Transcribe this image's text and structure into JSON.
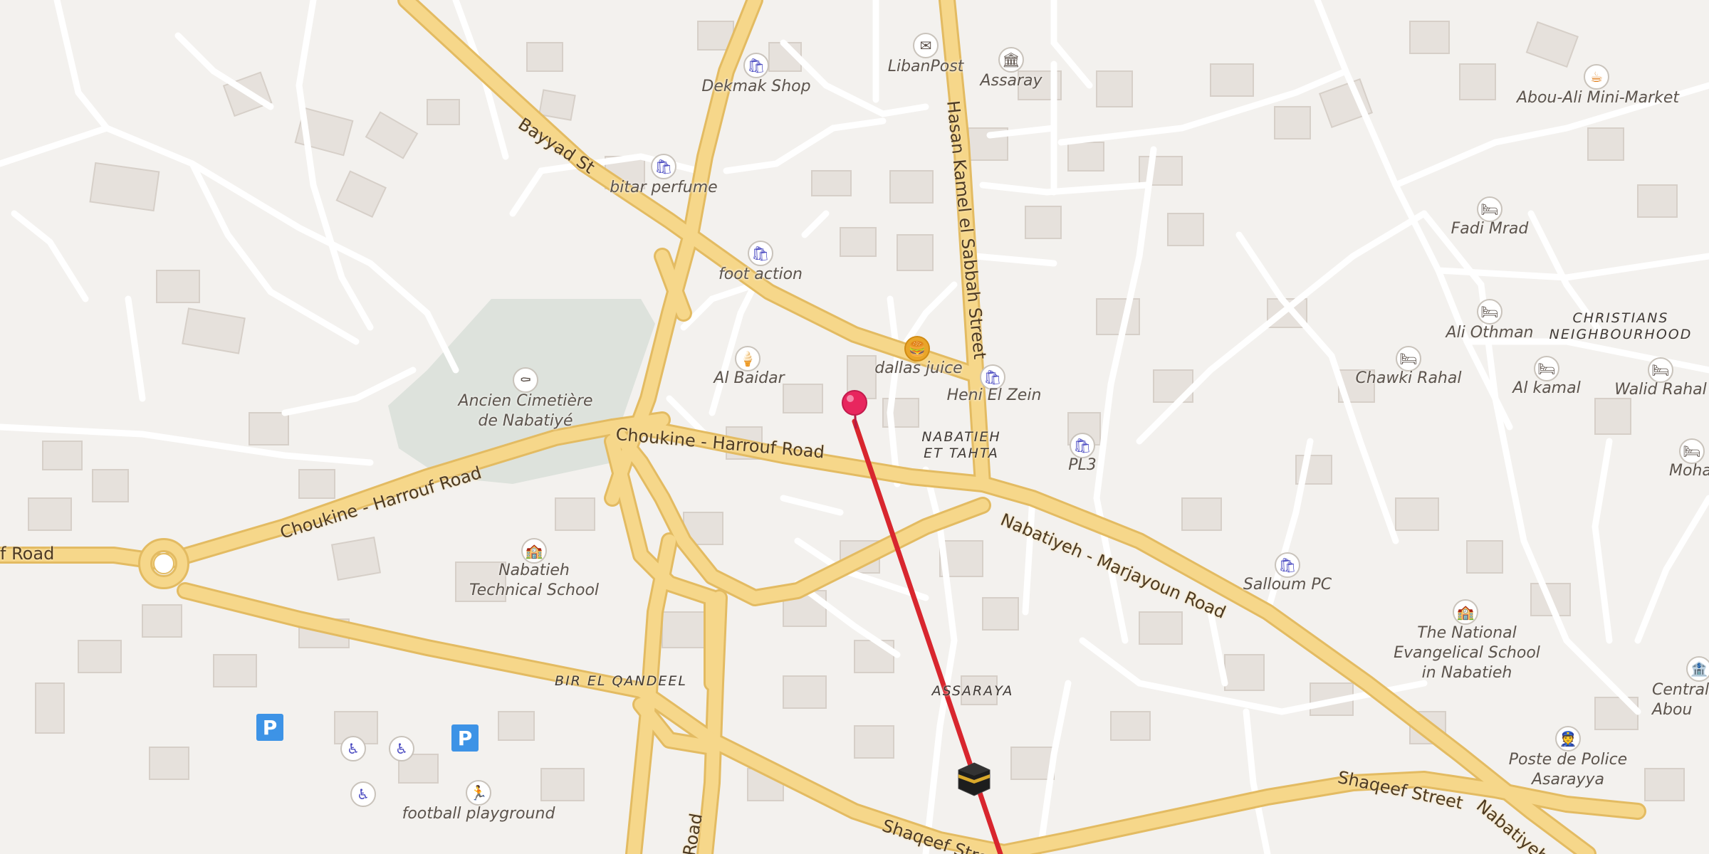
{
  "map": {
    "roads": {
      "choukine_harrouf_road_west": "Choukine - Harrouf Road",
      "choukine_harrouf_road_east": "Choukine - Harrouf Road",
      "road_fragment_west": "f Road",
      "bayyad_st": "Bayyad St",
      "hasan_kamel_el_sabbah_street": "Hasan Kamel el Sabbah Street",
      "nabatiyeh_marjayoun_road": "Nabatiyeh - Marjayoun Road",
      "shaqeef_street_south": "Shaqeef Stree",
      "shaqeef_street_east": "Shaqeef Street",
      "nabatiyeh_fragment": "Nabatiyeh - M",
      "road_fragment_bottom": "Road"
    },
    "areas": {
      "nabatieh_et_tahta": "NABATIEH\nET TAHTA",
      "christians_neighbourhood": "CHRISTIANS\nNEIGHBOURHOOD",
      "bir_el_qandeel": "BIR EL QANDEEL",
      "assaraya_area": "ASSARAYA"
    },
    "pois": {
      "dekmak_shop": "Dekmak Shop",
      "libanpost": "LibanPost",
      "assaray": "Assaray",
      "abou_ali_mini_market": "Abou-Ali Mini-Market",
      "bitar_perfume": "bitar perfume",
      "foot_action": "foot action",
      "fadi_mrad": "Fadi Mrad",
      "ali_othman": "Ali Othman",
      "chawki_rahal": "Chawki Rahal",
      "al_kamal": "Al kamal",
      "walid_rahal": "Walid Rahal",
      "mohamad_h": "Mohamad H",
      "dallas_juice": "dallas juice",
      "al_baidar": "Al Baidar",
      "heni_el_zein": "Heni El Zein",
      "pl3": "PL3",
      "ancien_cimetiere": "Ancien Cimetière\nde Nabatiyé",
      "nabatieh_technical_school": "Nabatieh\nTechnical School",
      "salloum_pc": "Salloum PC",
      "national_evangelical_school": "The National\nEvangelical School\nin Nabatieh",
      "central_abou": "Central\nAbou",
      "poste_de_police": "Poste de Police\nAsarayya",
      "football_playground": "football playground"
    },
    "parking_label": "P",
    "colors": {
      "background": "#f3f1ee",
      "building": "#e6e1dc",
      "building_edge": "#d6cfc8",
      "minor_road": "#ffffff",
      "major_road": "#f6d78a",
      "major_road_casing": "#e3bb62",
      "cemetery": "#dde2dc",
      "route_line": "#d8262e",
      "pin": "#e8265e",
      "shop_icon": "#4c4cc2",
      "parking": "#3d93e6"
    }
  }
}
